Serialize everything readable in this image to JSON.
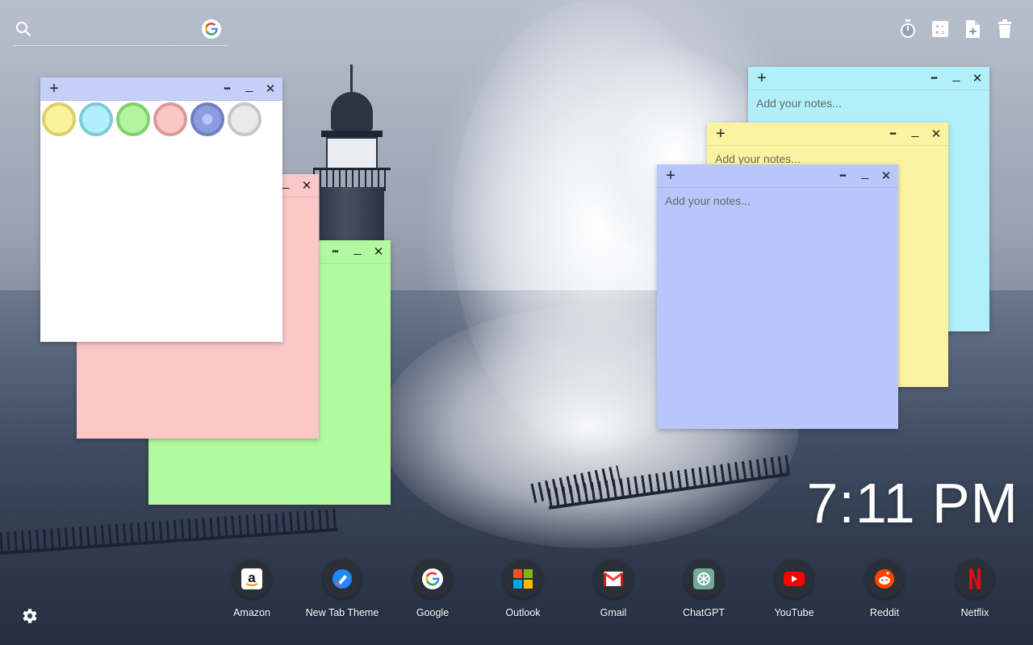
{
  "search": {
    "placeholder": "",
    "value": ""
  },
  "toolbar": {
    "icons": [
      "timer-icon",
      "calculator-icon",
      "add-note-icon",
      "trash-icon"
    ]
  },
  "notes": {
    "palette_note": {
      "color": "#ffffff",
      "header_color": "#c6cff8",
      "swatches": [
        {
          "name": "yellow",
          "fill": "#fbf39c",
          "ring": "#d9cf6d"
        },
        {
          "name": "cyan",
          "fill": "#b0effa",
          "ring": "#7ccbd9"
        },
        {
          "name": "green",
          "fill": "#b2f59e",
          "ring": "#82cf6e"
        },
        {
          "name": "pink",
          "fill": "#fbc6c6",
          "ring": "#d99a9a"
        },
        {
          "name": "blue",
          "fill": "#8d9be0",
          "ring": "#7280c2"
        },
        {
          "name": "gray",
          "fill": "#eaeaea",
          "ring": "#c6c6c6"
        }
      ]
    },
    "pink_note": {
      "color": "#fbc7c7"
    },
    "green_note": {
      "color": "#b2fa9f"
    },
    "cyan_note": {
      "color": "#b1f0fb",
      "placeholder": "Add your notes..."
    },
    "yellow_note": {
      "color": "#fcf3a1",
      "placeholder": "Add your notes..."
    },
    "blue_note": {
      "color": "#b9c6fb",
      "placeholder": "Add your notes..."
    },
    "header_buttons": {
      "plus": "+",
      "more": "•••",
      "minimize": "_",
      "close": "✕"
    }
  },
  "clock": {
    "time": "7:11 PM"
  },
  "shortcuts": [
    {
      "label": "Amazon",
      "icon": "amazon-icon"
    },
    {
      "label": "New Tab Theme",
      "icon": "new-tab-theme-icon"
    },
    {
      "label": "Google",
      "icon": "google-icon"
    },
    {
      "label": "Outlook",
      "icon": "outlook-icon"
    },
    {
      "label": "Gmail",
      "icon": "gmail-icon"
    },
    {
      "label": "ChatGPT",
      "icon": "chatgpt-icon"
    },
    {
      "label": "YouTube",
      "icon": "youtube-icon"
    },
    {
      "label": "Reddit",
      "icon": "reddit-icon"
    },
    {
      "label": "Netflix",
      "icon": "netflix-icon"
    }
  ]
}
